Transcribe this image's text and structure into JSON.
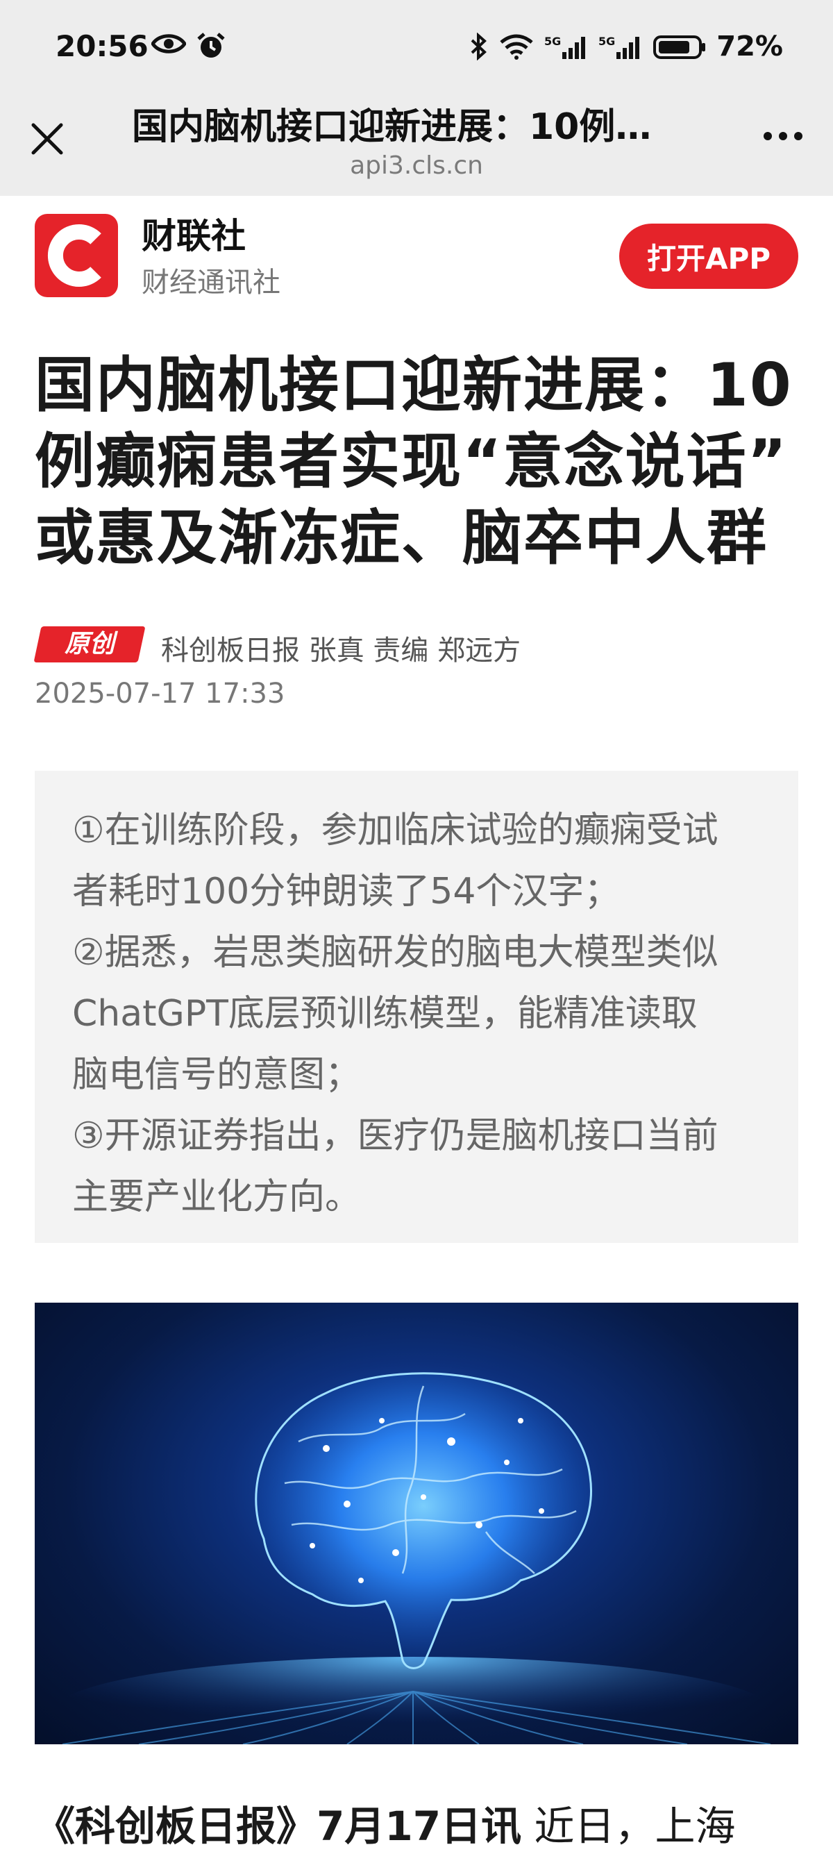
{
  "status_bar": {
    "time": "20:56",
    "battery": "72%",
    "icons": [
      "eye-icon",
      "alarm-icon",
      "bluetooth-icon",
      "wifi-icon",
      "signal-5g-icon",
      "signal-5g-icon",
      "battery-icon"
    ]
  },
  "nav": {
    "title": "国内脑机接口迎新进展：10例…",
    "url": "api3.cls.cn"
  },
  "brand": {
    "logo_letter": "C",
    "name": "财联社",
    "subtitle": "财经通讯社",
    "open_app_label": "打开APP",
    "color": "#e5232a"
  },
  "article": {
    "title_lines": [
      "国内脑机接口迎新进展：10",
      "例癫痫患者实现“意念说话”",
      "或惠及渐冻症、脑卒中人群"
    ],
    "badge": "原创",
    "source": "科创板日报 张真  责编 郑远方",
    "date": "2025-07-17 17:33",
    "summary_lines": [
      "①在训练阶段，参加临床试验的癫痫受试",
      "者耗时100分钟朗读了54个汉字；",
      "②据悉，岩思类脑研发的脑电大模型类似",
      "ChatGPT底层预训练模型，能精准读取",
      "脑电信号的意图；",
      "③开源证券指出，医疗仍是脑机接口当前",
      "主要产业化方向。"
    ],
    "lead_strong": "《科创板日报》7月17日讯",
    "lead_text": " 近日，上海"
  }
}
